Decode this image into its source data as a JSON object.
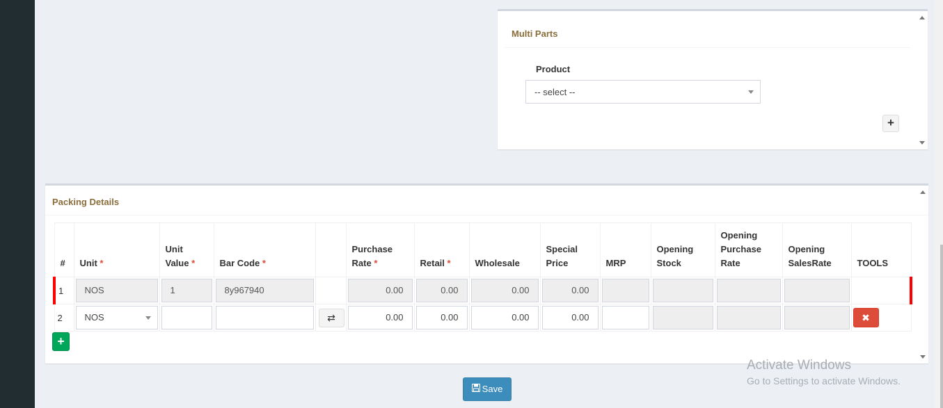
{
  "multi_parts": {
    "title": "Multi Parts",
    "product_label": "Product",
    "product_select_value": "-- select --",
    "add_label": "+"
  },
  "packing": {
    "title": "Packing Details",
    "columns": {
      "index": "#",
      "unit": "Unit",
      "unit_value": "Unit Value",
      "bar_code": "Bar Code",
      "purchase_rate": "Purchase Rate",
      "retail": "Retail",
      "wholesale": "Wholesale",
      "special_price": "Special Price",
      "mrp": "MRP",
      "opening_stock": "Opening Stock",
      "opening_purchase_rate": "Opening Purchase Rate",
      "opening_sales_rate": "Opening SalesRate",
      "tools": "TOOLS"
    },
    "required_mark": "*",
    "rows": [
      {
        "index": "1",
        "unit": "NOS",
        "unit_value": "1",
        "bar_code": "8y967940",
        "purchase_rate": "0.00",
        "retail": "0.00",
        "wholesale": "0.00",
        "special_price": "0.00",
        "mrp": "",
        "opening_stock": "",
        "opening_purchase_rate": "",
        "opening_sales_rate": ""
      },
      {
        "index": "2",
        "unit": "NOS",
        "unit_value": "",
        "bar_code": "",
        "purchase_rate": "0.00",
        "retail": "0.00",
        "wholesale": "0.00",
        "special_price": "0.00",
        "mrp": "",
        "opening_stock": "",
        "opening_purchase_rate": "",
        "opening_sales_rate": ""
      }
    ],
    "swap_icon": "⇄",
    "delete_icon": "✖",
    "add_row_label": "+"
  },
  "save": {
    "label": "Save",
    "icon": "floppy-disk-icon"
  },
  "watermark": {
    "line1": "Activate Windows",
    "line2": "Go to Settings to activate Windows."
  },
  "colors": {
    "sidebar": "#222d32",
    "background": "#ecf0f5",
    "title": "#8a6d3b",
    "primary": "#3c8dbc",
    "success": "#00a65a",
    "danger": "#dd4b39",
    "row_marker": "#ff0000"
  }
}
